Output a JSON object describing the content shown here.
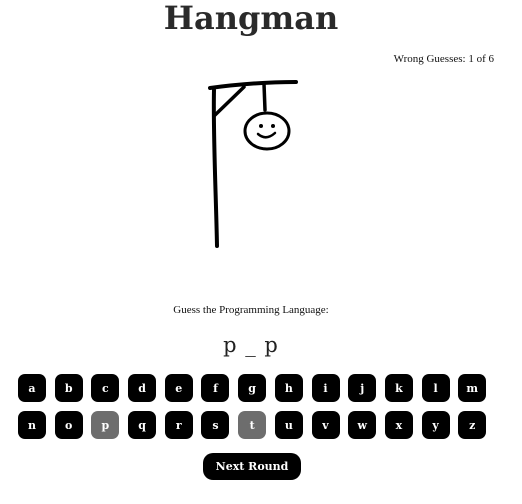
{
  "title": "Hangman",
  "wrong_guesses": "Wrong Guesses: 1 of 6",
  "prompt": "Guess the Programming Language:",
  "word_display": "p _ p",
  "keyboard": {
    "row1": [
      {
        "letter": "a",
        "used": false
      },
      {
        "letter": "b",
        "used": false
      },
      {
        "letter": "c",
        "used": false
      },
      {
        "letter": "d",
        "used": false
      },
      {
        "letter": "e",
        "used": false
      },
      {
        "letter": "f",
        "used": false
      },
      {
        "letter": "g",
        "used": false
      },
      {
        "letter": "h",
        "used": false
      },
      {
        "letter": "i",
        "used": false
      },
      {
        "letter": "j",
        "used": false
      },
      {
        "letter": "k",
        "used": false
      },
      {
        "letter": "l",
        "used": false
      },
      {
        "letter": "m",
        "used": false
      }
    ],
    "row2": [
      {
        "letter": "n",
        "used": false
      },
      {
        "letter": "o",
        "used": false
      },
      {
        "letter": "p",
        "used": true
      },
      {
        "letter": "q",
        "used": false
      },
      {
        "letter": "r",
        "used": false
      },
      {
        "letter": "s",
        "used": false
      },
      {
        "letter": "t",
        "used": true
      },
      {
        "letter": "u",
        "used": false
      },
      {
        "letter": "v",
        "used": false
      },
      {
        "letter": "w",
        "used": false
      },
      {
        "letter": "x",
        "used": false
      },
      {
        "letter": "y",
        "used": false
      },
      {
        "letter": "z",
        "used": false
      }
    ]
  },
  "next_round_label": "Next Round",
  "colors": {
    "key_bg": "#000000",
    "key_used_bg": "#6d6d6d",
    "key_text": "#ffffff"
  }
}
